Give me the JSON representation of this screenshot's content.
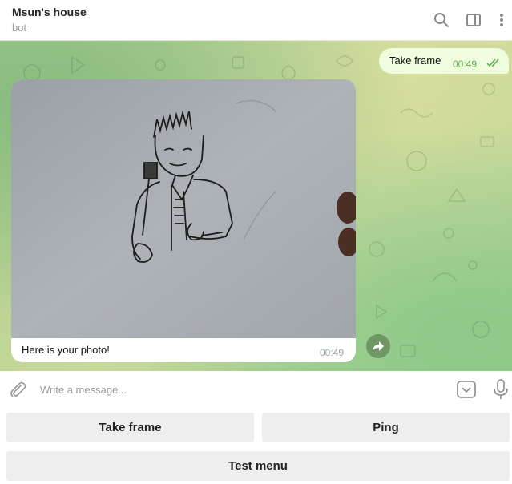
{
  "header": {
    "title": "Msun's house",
    "subtitle": "bot"
  },
  "messages": {
    "outgoing": {
      "text": "Take frame",
      "time": "00:49",
      "status": "read"
    },
    "incoming": {
      "caption": "Here is your photo!",
      "time": "00:49"
    }
  },
  "composer": {
    "placeholder": "Write a message..."
  },
  "keyboard": {
    "take_frame": "Take frame",
    "ping": "Ping",
    "test_menu": "Test menu"
  },
  "colors": {
    "accent": "#5fae4f",
    "out_bubble": "#effdde",
    "button_bg": "#eeeeee"
  }
}
